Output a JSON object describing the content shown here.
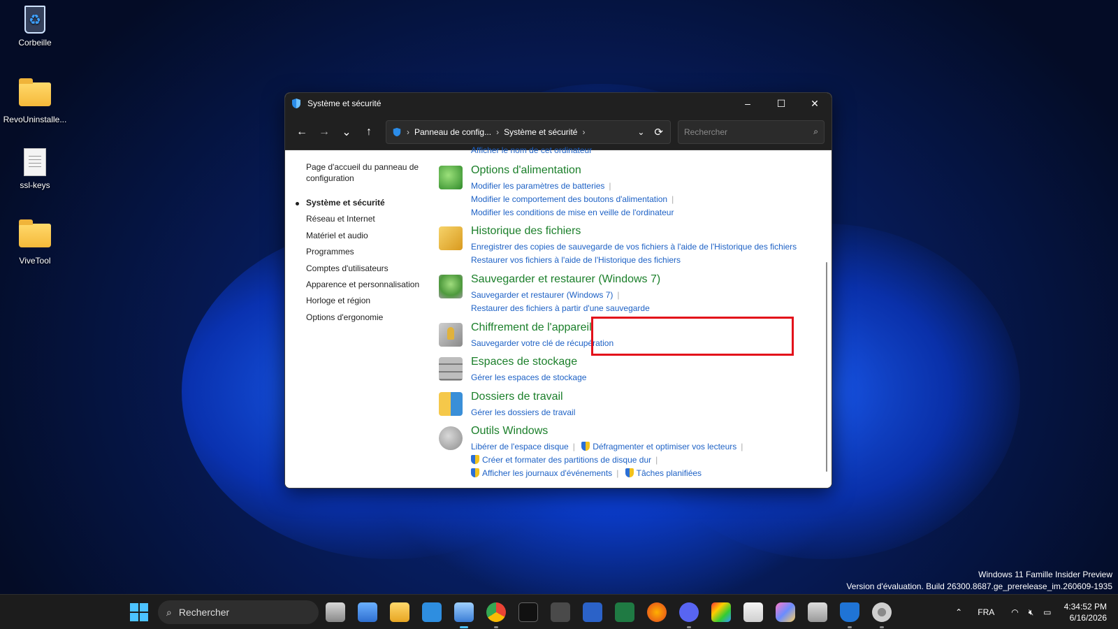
{
  "desktop": {
    "icons": [
      {
        "label": "Corbeille"
      },
      {
        "label": "RevoUninstalle..."
      },
      {
        "label": "ssl-keys"
      },
      {
        "label": "ViveTool"
      }
    ]
  },
  "window": {
    "title": "Système et sécurité",
    "controls": {
      "minimize": "–",
      "maximize": "☐",
      "close": "✕"
    },
    "nav": {
      "back": "←",
      "forward": "→",
      "recent": "⌄",
      "up": "↑",
      "refresh": "⟳"
    },
    "breadcrumb": [
      "Panneau de config...",
      "Système et sécurité"
    ],
    "search_placeholder": "Rechercher",
    "left_nav": {
      "home": "Page d'accueil du panneau de configuration",
      "items": [
        "Système et sécurité",
        "Réseau et Internet",
        "Matériel et audio",
        "Programmes",
        "Comptes d'utilisateurs",
        "Apparence et personnalisation",
        "Horloge et région",
        "Options d'ergonomie"
      ]
    },
    "partial_link": "Afficher le nom de cet ordinateur",
    "sections": [
      {
        "heading": "Options d'alimentation",
        "icon": "power-options-icon",
        "links": [
          "Modifier les paramètres de batteries",
          "Modifier le comportement des boutons d'alimentation",
          "Modifier les conditions de mise en veille de l'ordinateur"
        ]
      },
      {
        "heading": "Historique des fichiers",
        "icon": "file-history-icon",
        "links": [
          "Enregistrer des copies de sauvegarde de vos fichiers à l'aide de l'Historique des fichiers",
          "Restaurer vos fichiers à l'aide de l'Historique des fichiers"
        ]
      },
      {
        "heading": "Sauvegarder et restaurer (Windows 7)",
        "icon": "backup-restore-icon",
        "links": [
          "Sauvegarder et restaurer (Windows 7)",
          "Restaurer des fichiers à partir d'une sauvegarde"
        ]
      },
      {
        "heading": "Chiffrement de l'appareil",
        "icon": "device-encryption-icon",
        "links": [
          "Sauvegarder votre clé de récupération"
        ]
      },
      {
        "heading": "Espaces de stockage",
        "icon": "storage-spaces-icon",
        "links": [
          "Gérer les espaces de stockage"
        ]
      },
      {
        "heading": "Dossiers de travail",
        "icon": "work-folders-icon",
        "links": [
          "Gérer les dossiers de travail"
        ]
      },
      {
        "heading": "Outils Windows",
        "icon": "windows-tools-icon",
        "links": [
          "Libérer de l'espace disque",
          "Défragmenter et optimiser vos lecteurs",
          "Créer et formater des partitions de disque dur",
          "Afficher les journaux d'événements",
          "Tâches planifiées"
        ]
      }
    ]
  },
  "watermark": {
    "line1": "Windows 11 Famille Insider Preview",
    "line2": "Version d'évaluation. Build 26300.8687.ge_prerelease_im.260609-1935"
  },
  "taskbar": {
    "search_label": "Rechercher",
    "language": "FRA",
    "time": "4:34:52 PM",
    "date": "6/16/2026"
  },
  "colors": {
    "heading_green": "#1b7f2a",
    "link_blue": "#1d61c5",
    "highlight_red": "#e3101a",
    "accent": "#4cc2ff"
  }
}
